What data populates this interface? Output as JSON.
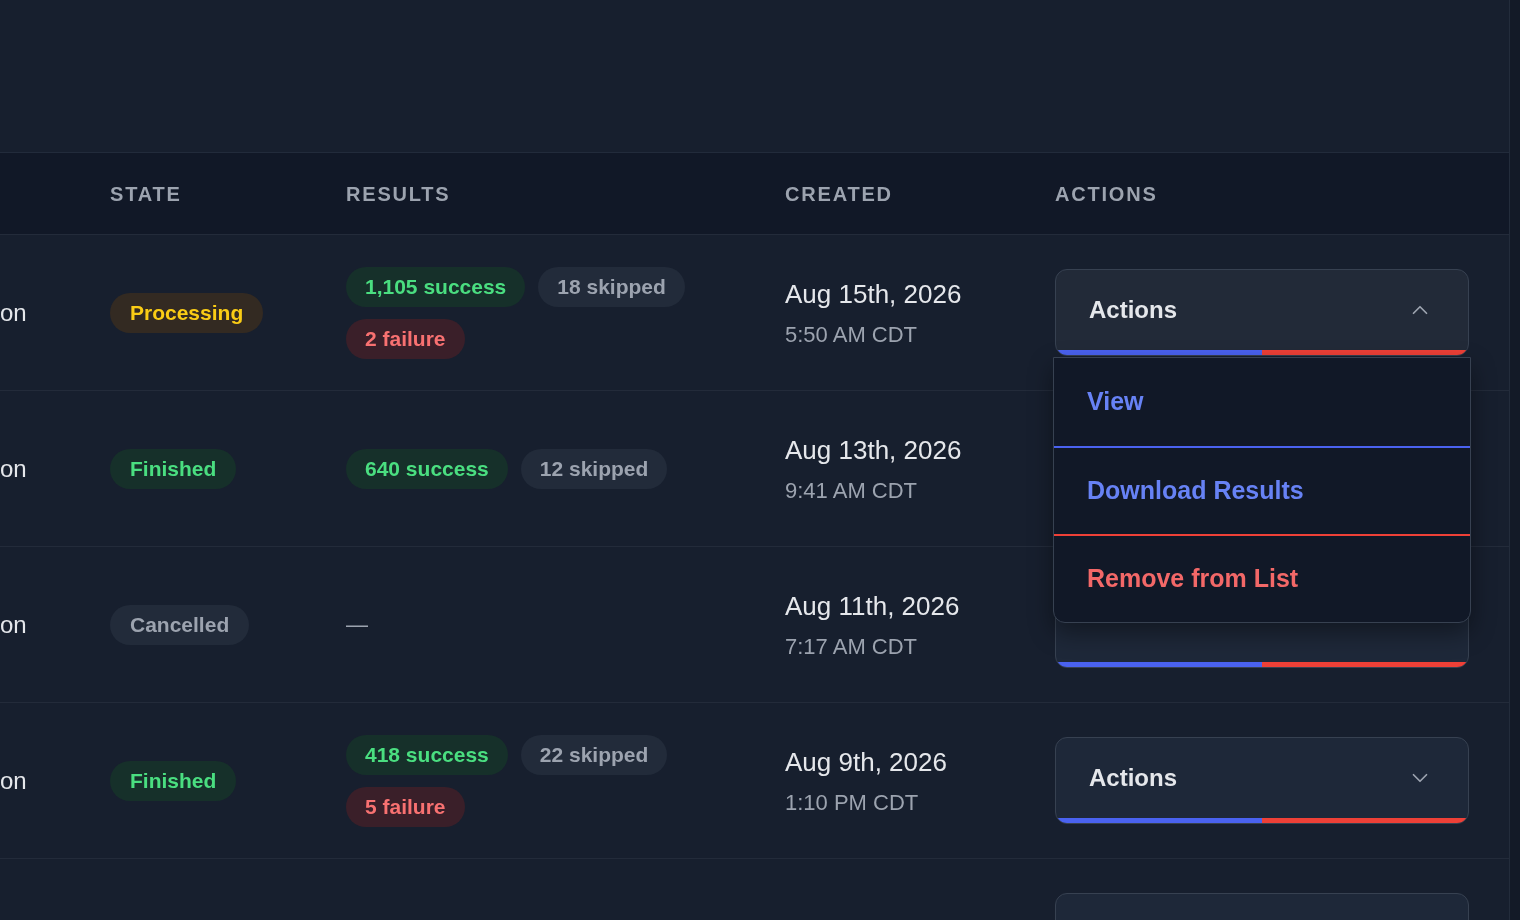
{
  "table": {
    "columns": [
      "STATE",
      "RESULTS",
      "CREATED",
      "ACTIONS"
    ],
    "rows": [
      {
        "column_1": "on",
        "state": {
          "kind": "processing",
          "label": "Processing"
        },
        "results": [
          {
            "kind": "success",
            "label": "1,105 success"
          },
          {
            "kind": "skipped",
            "label": "18 skipped"
          },
          {
            "kind": "failure",
            "label": "2 failure"
          }
        ],
        "created": {
          "date": "Aug 15th, 2026",
          "time": "5:50 AM CDT"
        },
        "actions": {
          "label": "Actions",
          "expanded": true,
          "menu": [
            {
              "kind": "normal",
              "label": "View"
            },
            {
              "kind": "normal",
              "label": "Download Results"
            },
            {
              "kind": "danger",
              "label": "Remove from List"
            }
          ]
        }
      },
      {
        "column_1": "on",
        "state": {
          "kind": "finished",
          "label": "Finished"
        },
        "results": [
          {
            "kind": "success",
            "label": "640 success"
          },
          {
            "kind": "skipped",
            "label": "12 skipped"
          }
        ],
        "created": {
          "date": "Aug 13th, 2026",
          "time": "9:41 AM CDT"
        }
      },
      {
        "column_1": "on",
        "state": {
          "kind": "cancelled",
          "label": "Cancelled"
        },
        "results": [
          {
            "kind": "none",
            "label": "—"
          }
        ],
        "created": {
          "date": "Aug 11th, 2026",
          "time": "7:17 AM CDT"
        },
        "actions": {}
      },
      {
        "column_1": "on",
        "state": {
          "kind": "finished",
          "label": "Finished"
        },
        "results": [
          {
            "kind": "success",
            "label": "418 success"
          },
          {
            "kind": "skipped",
            "label": "22 skipped"
          },
          {
            "kind": "failure",
            "label": "5 failure"
          }
        ],
        "created": {
          "date": "Aug 9th, 2026",
          "time": "1:10 PM CDT"
        },
        "actions": {
          "label": "Actions",
          "expanded": false
        }
      },
      {
        "actions": {}
      }
    ]
  }
}
